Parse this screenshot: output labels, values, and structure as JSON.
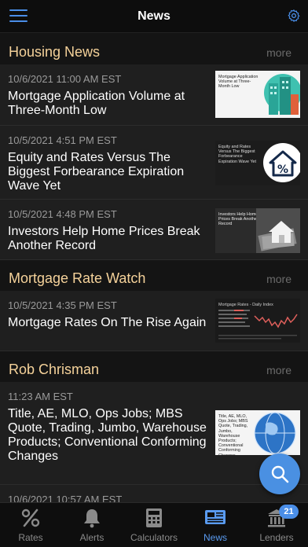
{
  "header": {
    "title": "News",
    "menu_icon": "hamburger-menu-icon",
    "settings_icon": "gear-icon"
  },
  "sections": [
    {
      "title": "Housing News",
      "more": "more",
      "articles": [
        {
          "date": "10/6/2021 11:00 AM EST",
          "headline": "Mortgage Application Volume at Three-Month Low",
          "thumb_caption": "Mortgage Application Volume at Three-Month Low",
          "thumb_icon": "city-buildings-icon"
        },
        {
          "date": "10/5/2021 4:51 PM EST",
          "headline": "Equity and Rates Versus The Biggest Forbearance Expiration Wave Yet",
          "thumb_caption": "Equity and Rates Versus The Biggest Forbearance Expiration Wave Yet",
          "thumb_icon": "house-percent-icon"
        },
        {
          "date": "10/5/2021 4:48 PM EST",
          "headline": "Investors Help Home Prices Break Another Record",
          "thumb_caption": "Investors Help Home Prices Break Another Record",
          "thumb_icon": "house-money-icon"
        }
      ]
    },
    {
      "title": "Mortgage Rate Watch",
      "more": "more",
      "articles": [
        {
          "date": "10/5/2021 4:35 PM EST",
          "headline": "Mortgage Rates On The Rise Again",
          "thumb_caption": "Mortgage Rates - Daily Index",
          "thumb_icon": "rate-chart-icon"
        }
      ]
    },
    {
      "title": "Rob Chrisman",
      "more": "more",
      "articles": [
        {
          "date": "11:23 AM EST",
          "headline": "Title, AE, MLO, Ops Jobs; MBS Quote, Trading, Jumbo, Warehouse Products; Conventional Conforming Changes",
          "thumb_caption": "Title, AE, MLO, Ops Jobs; MBS Quote, Trading, Jumbo, Warehouse Products; Conventional Conforming Changes",
          "thumb_icon": "globe-icon"
        },
        {
          "date": "10/6/2021 10:57 AM EST",
          "headline": ""
        }
      ]
    }
  ],
  "tabs": [
    {
      "label": "Rates",
      "icon": "percent-icon",
      "active": false
    },
    {
      "label": "Alerts",
      "icon": "bell-icon",
      "active": false
    },
    {
      "label": "Calculators",
      "icon": "calculator-icon",
      "active": false
    },
    {
      "label": "News",
      "icon": "newspaper-icon",
      "active": true
    },
    {
      "label": "Lenders",
      "icon": "bank-icon",
      "active": false
    }
  ],
  "lenders_badge": "21",
  "search_fab_icon": "search-icon",
  "colors": {
    "accent": "#4a8ee8",
    "section_title": "#f5d29a",
    "background": "#141414",
    "card": "#1f1f1f"
  }
}
